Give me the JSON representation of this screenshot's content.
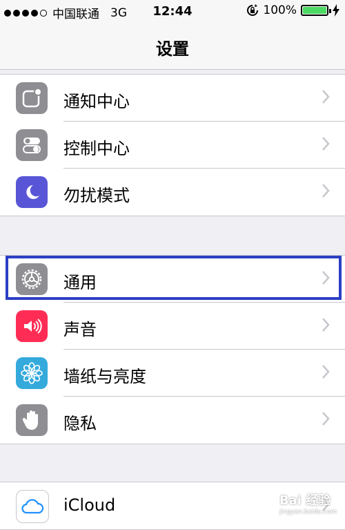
{
  "status_bar": {
    "carrier": "中国联通",
    "network": "3G",
    "time": "12:44",
    "battery": "100%",
    "battery_level": 1.0
  },
  "nav": {
    "title": "设置"
  },
  "groups": [
    {
      "rows": [
        {
          "label": "通知中心",
          "icon": "notification-center-icon",
          "color": "#8e8e93"
        },
        {
          "label": "控制中心",
          "icon": "control-center-icon",
          "color": "#8e8e93"
        },
        {
          "label": "勿扰模式",
          "icon": "moon-icon",
          "color": "#5856d6"
        }
      ]
    },
    {
      "rows": [
        {
          "label": "通用",
          "icon": "gear-icon",
          "color": "#8e8e93"
        },
        {
          "label": "声音",
          "icon": "speaker-icon",
          "color": "#ff2d55"
        },
        {
          "label": "墙纸与亮度",
          "icon": "wallpaper-icon",
          "color": "#34aadc"
        },
        {
          "label": "隐私",
          "icon": "hand-icon",
          "color": "#8e8e93"
        }
      ]
    },
    {
      "rows": [
        {
          "label": "iCloud",
          "icon": "cloud-icon",
          "color": "#1e90ff"
        }
      ]
    }
  ],
  "highlight_color": "#2b3fc4",
  "watermark": {
    "brand": "Bai 经验",
    "url": "jingyan.baidu.com"
  }
}
